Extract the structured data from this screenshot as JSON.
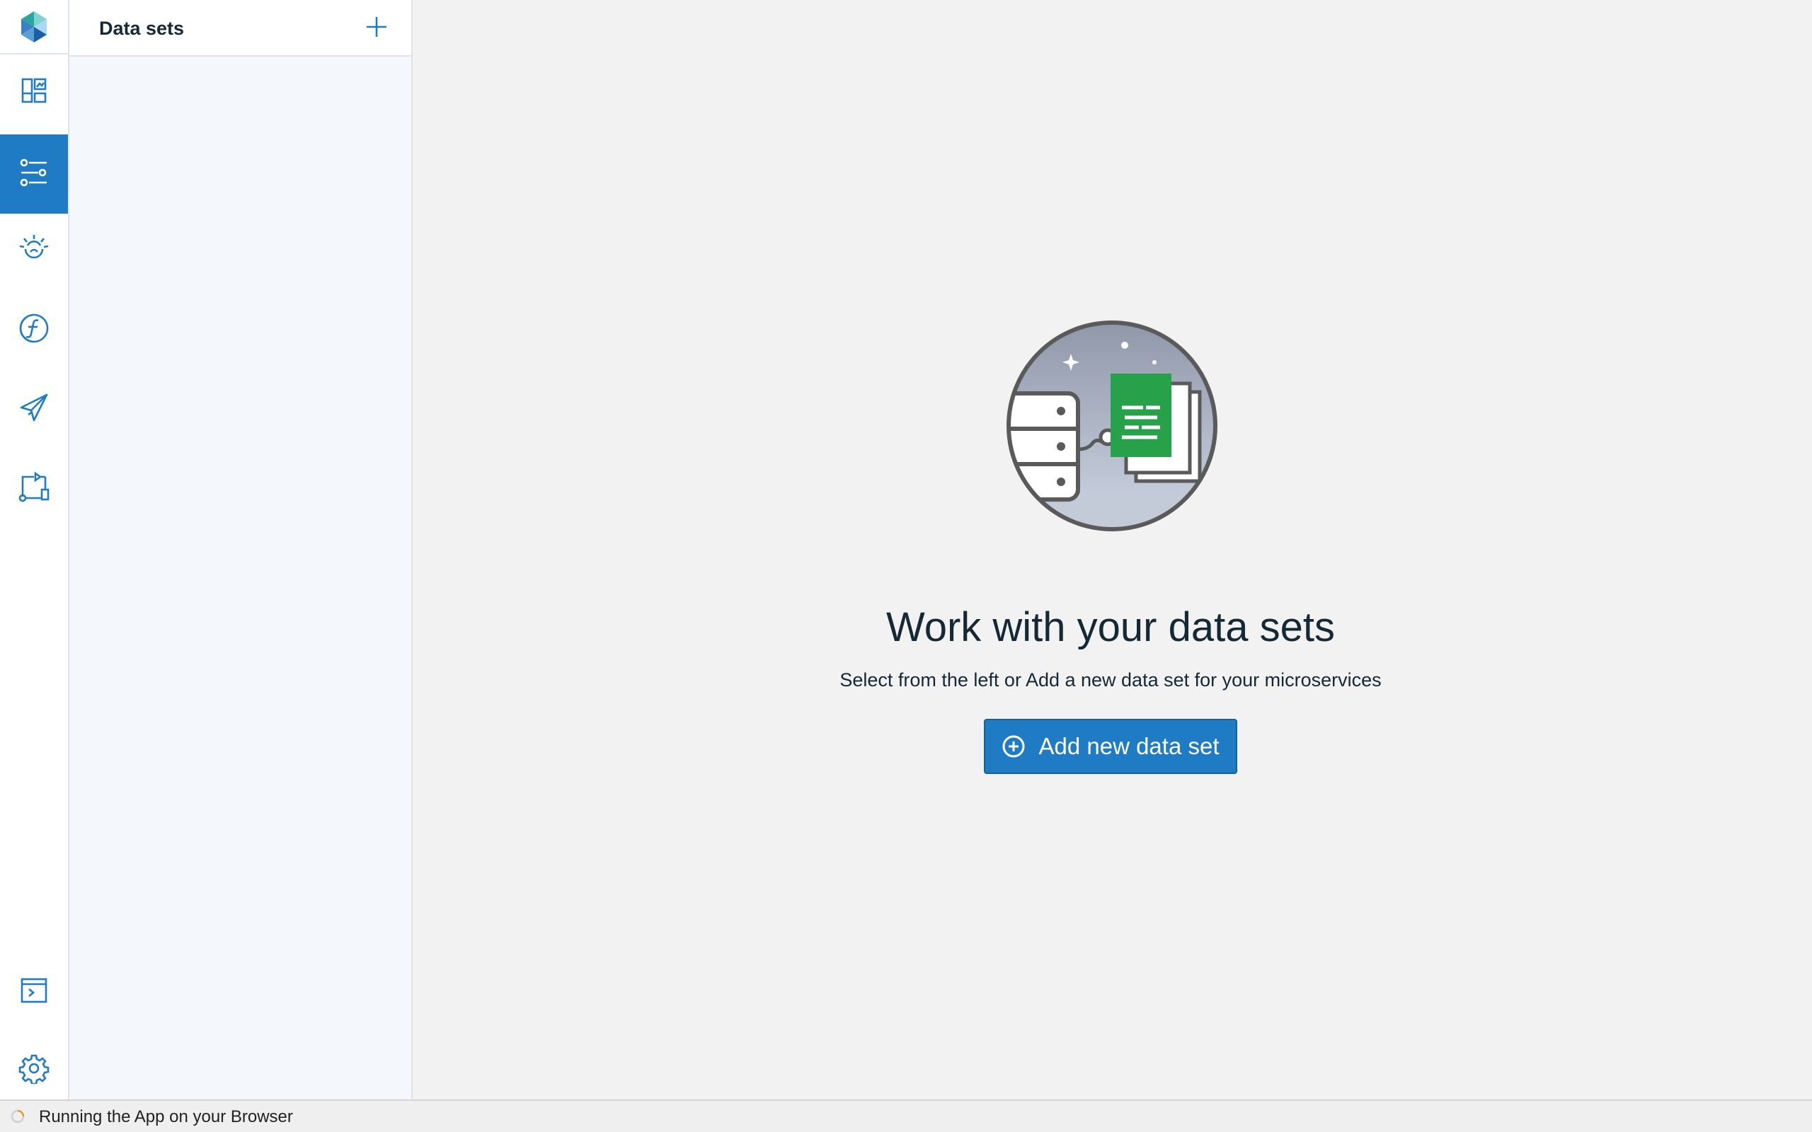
{
  "rail": {
    "logo_icon": "app-logo-icon",
    "items": [
      {
        "icon": "dashboard-icon",
        "active": false
      },
      {
        "icon": "settings-sliders-icon",
        "active": true
      },
      {
        "icon": "ibm-watson-icon",
        "active": false
      },
      {
        "icon": "functions-icon",
        "active": false
      },
      {
        "icon": "send-icon",
        "active": false
      },
      {
        "icon": "flow-icon",
        "active": false
      },
      {
        "icon": "terminal-icon",
        "active": false
      },
      {
        "icon": "gear-icon",
        "active": false
      }
    ],
    "active_color": "#1f7cc4",
    "icon_color": "#1f7cc4"
  },
  "panel": {
    "title": "Data sets",
    "add_icon": "plus-icon"
  },
  "main": {
    "illustration": "data-set-illustration",
    "title": "Work with your data sets",
    "subtitle": "Select from the left or Add a new data set for your microservices",
    "add_button_label": "Add new data set",
    "add_button_icon": "plus-circle-icon",
    "button_color": "#1f7cc4"
  },
  "statusbar": {
    "text": "Running the App on your Browser",
    "icon": "spinner-icon"
  }
}
